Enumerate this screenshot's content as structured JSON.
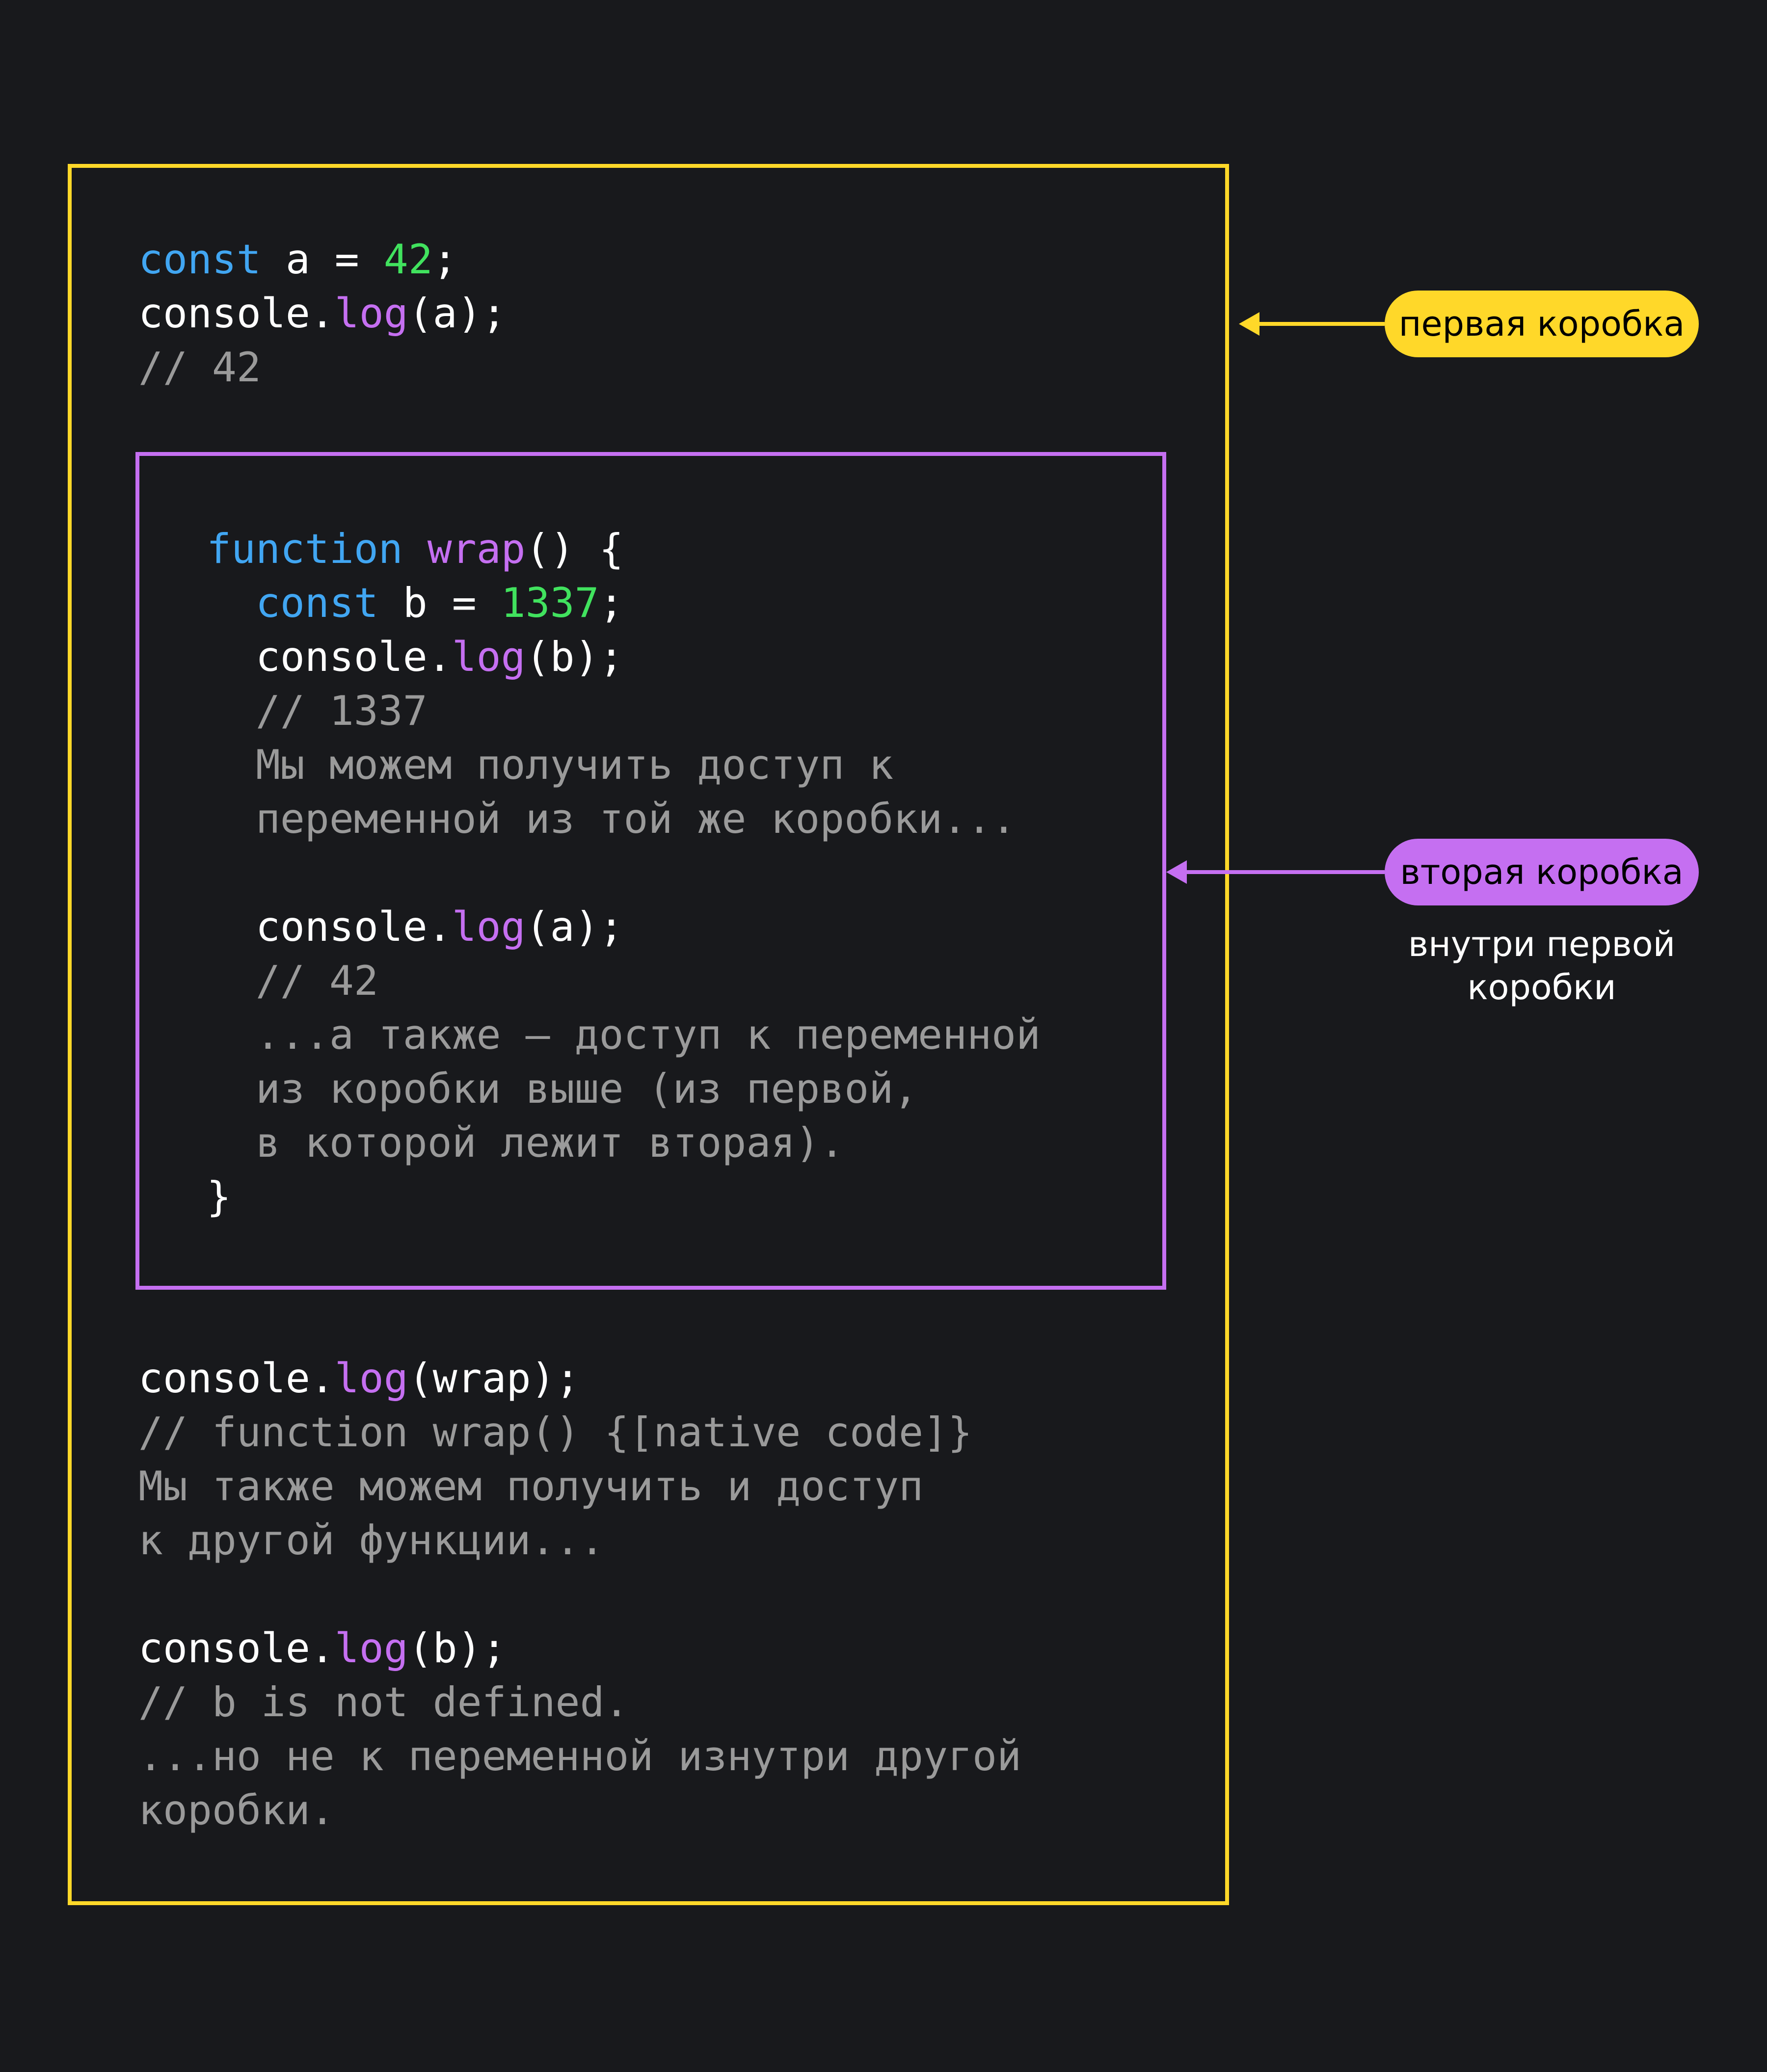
{
  "colors": {
    "background": "#18191c",
    "outer_box": "#ffd829",
    "inner_box": "#c56ff1",
    "keyword": "#41a6f2",
    "number": "#41e25e",
    "method": "#c56ff1",
    "comment": "#9a9a9a",
    "text": "#ffffff"
  },
  "code_top": {
    "l1_kw": "const",
    "l1_rest": " a = ",
    "l1_num": "42",
    "l1_end": ";",
    "l2_obj": "console.",
    "l2_fn": "log",
    "l2_rest": "(a);",
    "l3_comment": "// 42"
  },
  "code_inner": {
    "l1_kw": "function",
    "l1_sp": " ",
    "l1_fn": "wrap",
    "l1_rest": "() {",
    "l2_indent": "  ",
    "l2_kw": "const",
    "l2_rest": " b = ",
    "l2_num": "1337",
    "l2_end": ";",
    "l3_obj": "  console.",
    "l3_fn": "log",
    "l3_rest": "(b);",
    "l4_comment": "  // 1337",
    "l5_comment": "  Мы можем получить доступ к",
    "l6_comment": "  переменной из той же коробки...",
    "l8_obj": "  console.",
    "l8_fn": "log",
    "l8_rest": "(a);",
    "l9_comment": "  // 42",
    "l10_comment": "  ...а также — доступ к переменной",
    "l11_comment": "  из коробки выше (из первой,",
    "l12_comment": "  в которой лежит вторая).",
    "l13_close": "}"
  },
  "code_bottom": {
    "l1_obj": "console.",
    "l1_fn": "log",
    "l1_rest": "(wrap);",
    "l2_comment": "// function wrap() {[native code]}",
    "l3_comment": "Мы также можем получить и доступ",
    "l4_comment": "к другой функции...",
    "l6_obj": "console.",
    "l6_fn": "log",
    "l6_rest": "(b);",
    "l7_comment": "// b is not defined.",
    "l8_comment": "...но не к переменной изнутри другой",
    "l9_comment": "коробки."
  },
  "labels": {
    "first_box": "первая коробка",
    "second_box": "вторая коробка",
    "second_box_note_line1": "внутри первой",
    "second_box_note_line2": "коробки"
  }
}
